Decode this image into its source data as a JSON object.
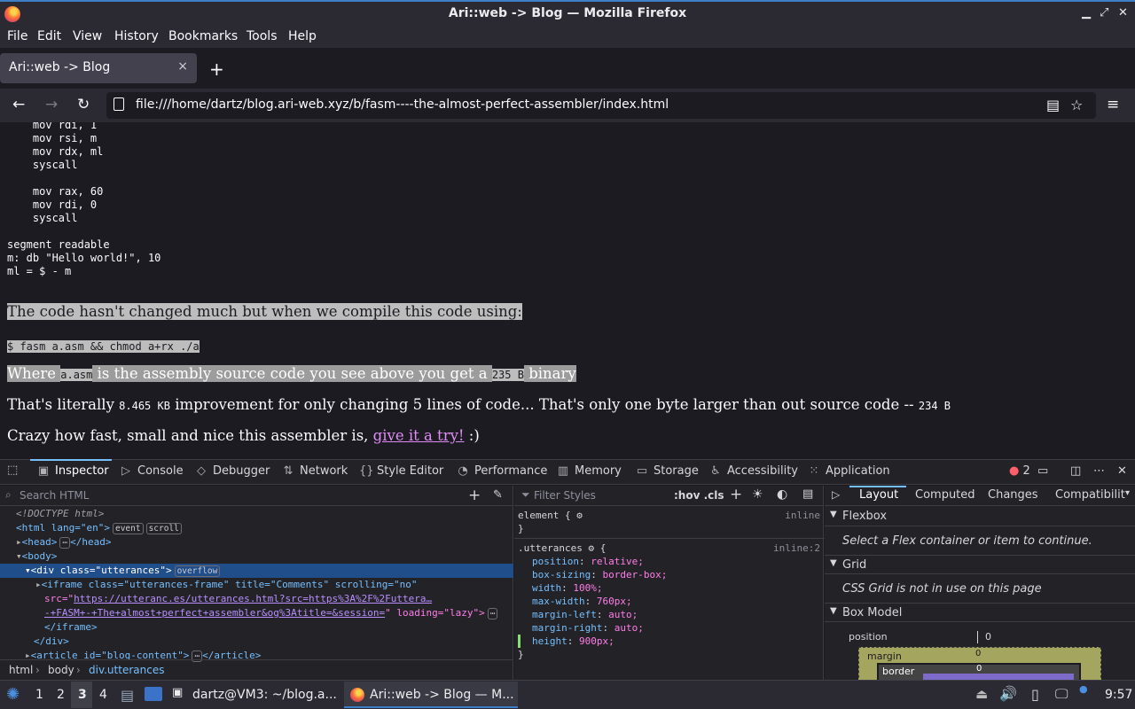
{
  "window": {
    "title": "Ari::web -> Blog — Mozilla Firefox"
  },
  "menu": [
    "File",
    "Edit",
    "View",
    "History",
    "Bookmarks",
    "Tools",
    "Help"
  ],
  "tab": {
    "label": "Ari::web -> Blog",
    "close": "×"
  },
  "nav": {
    "url": "file:///home/dartz/blog.ari-web.xyz/b/fasm----the-almost-perfect-assembler/index.html"
  },
  "content": {
    "code": "    mov rdi, 1\n    mov rsi, m\n    mov rdx, ml\n    syscall\n\n    mov rax, 60\n    mov rdi, 0\n    syscall\n\nsegment readable\nm: db \"Hello world!\", 10\nml = $ - m",
    "p1": "The code hasn't changed much but when we compile this code using:",
    "cmd": "$ fasm a.asm && chmod a+rx ./a",
    "p3_a": "Where ",
    "p3_code1": "a.asm",
    "p3_b": " is the assembly source code you see above you get a ",
    "p3_code2": "235 B",
    "p3_c": " binary",
    "p4_a": "That's literally ",
    "p4_code1": "8.465 KB",
    "p4_b": " improvement for only changing 5 lines of code... That's only one byte larger than out source code -- ",
    "p4_code2": "234 B",
    "p5_a": "Crazy how fast, small and nice this assembler is, ",
    "p5_link": "give it a try!",
    "p5_b": " :)"
  },
  "devtools": {
    "tabs": [
      "Inspector",
      "Console",
      "Debugger",
      "Network",
      "Style Editor",
      "Performance",
      "Memory",
      "Storage",
      "Accessibility",
      "Application"
    ],
    "error_count": "2",
    "search_placeholder": "Search HTML",
    "tree": {
      "doctype": "<!DOCTYPE html>",
      "html_open": "<html lang=\"en\">",
      "badge_event": "event",
      "badge_scroll": "scroll",
      "head": "<head>",
      "head_close": "</head>",
      "body": "<body>",
      "div_utterances": "<div class=\"utterances\">",
      "badge_overflow": "overflow",
      "iframe_line1": "<iframe class=\"utterances-frame\" title=\"Comments\" scrolling=\"no\"",
      "iframe_src_attr": "src=\"",
      "iframe_src_1": "https://utteranc.es/utterances.html?src=https%3A%2F%2Futtera…",
      "iframe_src_2": "-+FASM+-+The+almost+perfect+assembler&og%3Atitle=&session=",
      "iframe_loading": "\" loading=\"lazy\">",
      "iframe_close": "</iframe>",
      "div_close": "</div>",
      "article": "<article id=\"blog-content\">",
      "article_close": "</article>"
    },
    "breadcrumb": [
      "html",
      "body",
      "div.utterances"
    ],
    "filter_placeholder": "Filter Styles",
    "hov_cls": ":hov .cls",
    "rules": {
      "element_sel": "element {",
      "element_src": "inline",
      "utter_sel": ".utterances",
      "utter_src": "inline:2",
      "decls": [
        {
          "p": "position",
          "v": "relative;"
        },
        {
          "p": "box-sizing",
          "v": "border-box;"
        },
        {
          "p": "width",
          "v": "100%;"
        },
        {
          "p": "max-width",
          "v": "760px;"
        },
        {
          "p": "margin-left",
          "v": "auto;"
        },
        {
          "p": "margin-right",
          "v": "auto;"
        },
        {
          "p": "height",
          "v": "900px;"
        }
      ]
    },
    "right_tabs": [
      "Layout",
      "Computed",
      "Changes",
      "Compatibilit"
    ],
    "flexbox": "Flexbox",
    "flexbox_note": "Select a Flex container or item to continue.",
    "grid": "Grid",
    "grid_note": "CSS Grid is not in use on this page",
    "boxmodel": "Box Model",
    "position_label": "position",
    "position_val": "0",
    "margin_label": "margin",
    "margin_val": "0",
    "border_label": "border",
    "border_val": "0"
  },
  "taskbar": {
    "workspaces": [
      "1",
      "2",
      "3",
      "4"
    ],
    "terminal": "dartz@VM3: ~/blog.a...",
    "firefox": "Ari::web -> Blog — M...",
    "clock": "9:57"
  }
}
